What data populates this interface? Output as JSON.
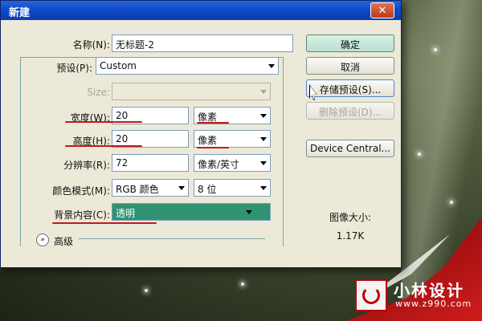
{
  "dialog": {
    "title": "新建",
    "close_symbol": "✕"
  },
  "form": {
    "name_label": "名称(N):",
    "name_value": "无标题-2",
    "preset_label": "预设(P):",
    "preset_value": "Custom",
    "size_label": "Size:",
    "size_value": "",
    "width_label": "宽度(W):",
    "width_value": "20",
    "width_unit": "像素",
    "height_label": "高度(H):",
    "height_value": "20",
    "height_unit": "像素",
    "resolution_label": "分辨率(R):",
    "resolution_value": "72",
    "resolution_unit": "像素/英寸",
    "color_mode_label": "颜色模式(M):",
    "color_mode_value": "RGB 颜色",
    "bit_depth_value": "8 位",
    "background_label": "背景内容(C):",
    "background_value": "透明",
    "advanced_label": "高级",
    "advanced_icon": "»"
  },
  "buttons": {
    "ok": "确定",
    "cancel": "取消",
    "save_preset": "存储预设(S)...",
    "delete_preset": "删除预设(D)...",
    "device_central": "Device Central..."
  },
  "info": {
    "image_size_label": "图像大小:",
    "image_size_value": "1.17K"
  },
  "brand": {
    "name": "小林设计",
    "url": "www.z990.com"
  },
  "colors": {
    "titlebar": "#0c49c7",
    "highlight": "#2f9373",
    "annotation": "#c21a1a"
  }
}
